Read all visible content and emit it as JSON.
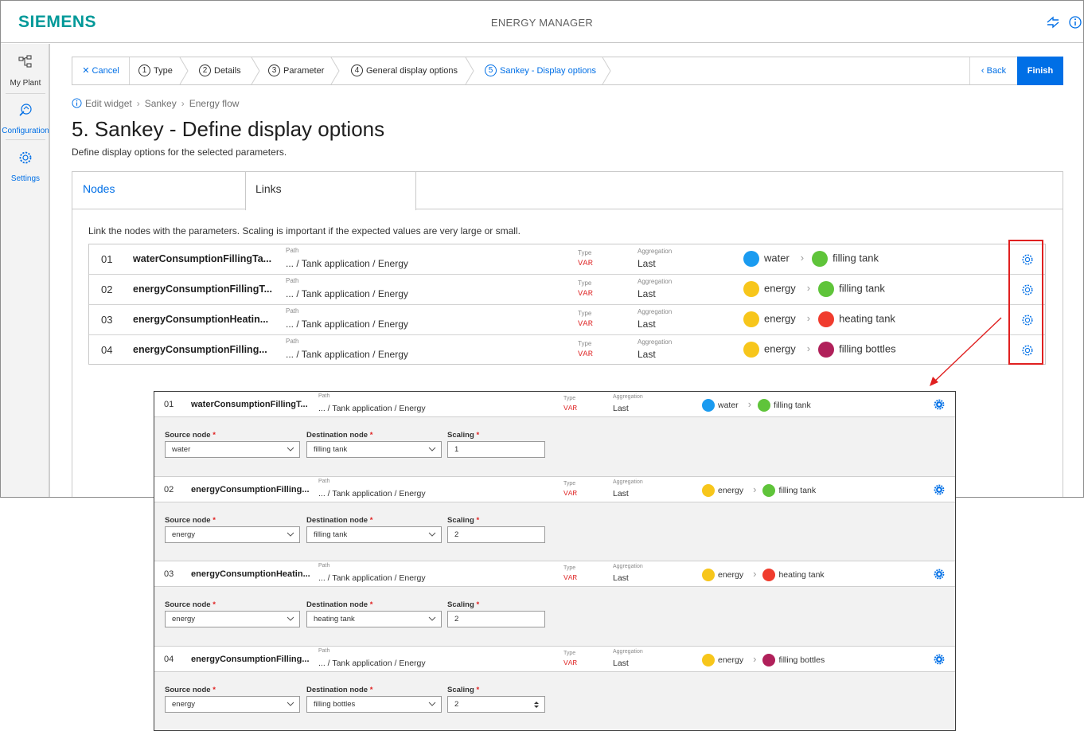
{
  "app": {
    "brand": "SIEMENS",
    "title": "ENERGY MANAGER",
    "colors": {
      "brand": "#009999",
      "accent": "#006fe6",
      "highlight": "#e02020"
    }
  },
  "sidebar": {
    "items": [
      {
        "label": "My Plant",
        "icon": "plant-tree-icon"
      },
      {
        "label": "Configuration",
        "icon": "configuration-icon"
      },
      {
        "label": "Settings",
        "icon": "gear-icon"
      }
    ]
  },
  "wizard": {
    "cancel": "Cancel",
    "steps": [
      {
        "num": "1",
        "label": "Type"
      },
      {
        "num": "2",
        "label": "Details"
      },
      {
        "num": "3",
        "label": "Parameter"
      },
      {
        "num": "4",
        "label": "General display options"
      },
      {
        "num": "5",
        "label": "Sankey - Display options"
      }
    ],
    "back": "Back",
    "finish": "Finish"
  },
  "breadcrumb": [
    "Edit widget",
    "Sankey",
    "Energy flow"
  ],
  "page": {
    "title": "5. Sankey - Define display options",
    "subtitle": "Define display options for the selected parameters."
  },
  "tabs": [
    "Nodes",
    "Links"
  ],
  "links_description": "Link the nodes with the parameters. Scaling is important if the expected values are very large or small.",
  "labels": {
    "path": "Path",
    "type": "Type",
    "aggregation": "Aggregation",
    "source_node": "Source node",
    "destination_node": "Destination node",
    "scaling": "Scaling",
    "required": "*"
  },
  "links": [
    {
      "num": "01",
      "name": "waterConsumptionFillingTa...",
      "path": "... / Tank application / Energy",
      "type": "VAR",
      "aggregation": "Last",
      "source": "water",
      "source_color": "#1a9bf0",
      "destination": "filling tank",
      "destination_color": "#5fc43a"
    },
    {
      "num": "02",
      "name": "energyConsumptionFillingT...",
      "path": "... / Tank application / Energy",
      "type": "VAR",
      "aggregation": "Last",
      "source": "energy",
      "source_color": "#f7c61b",
      "destination": "filling tank",
      "destination_color": "#5fc43a"
    },
    {
      "num": "03",
      "name": "energyConsumptionHeatin...",
      "path": "... / Tank application / Energy",
      "type": "VAR",
      "aggregation": "Last",
      "source": "energy",
      "source_color": "#f7c61b",
      "destination": "heating tank",
      "destination_color": "#f03c2e"
    },
    {
      "num": "04",
      "name": "energyConsumptionFilling...",
      "path": "... / Tank application / Energy",
      "type": "VAR",
      "aggregation": "Last",
      "source": "energy",
      "source_color": "#f7c61b",
      "destination": "filling bottles",
      "destination_color": "#b0205a"
    }
  ],
  "expanded_links": [
    {
      "num": "01",
      "name": "waterConsumptionFillingT...",
      "path": "... / Tank application / Energy",
      "type": "VAR",
      "aggregation": "Last",
      "source": "water",
      "source_color": "#1a9bf0",
      "destination": "filling tank",
      "destination_color": "#5fc43a",
      "source_select": "water",
      "destination_select": "filling tank",
      "scaling": "1"
    },
    {
      "num": "02",
      "name": "energyConsumptionFilling...",
      "path": "... / Tank application / Energy",
      "type": "VAR",
      "aggregation": "Last",
      "source": "energy",
      "source_color": "#f7c61b",
      "destination": "filling tank",
      "destination_color": "#5fc43a",
      "source_select": "energy",
      "destination_select": "filling tank",
      "scaling": "2"
    },
    {
      "num": "03",
      "name": "energyConsumptionHeatin...",
      "path": "... / Tank application / Energy",
      "type": "VAR",
      "aggregation": "Last",
      "source": "energy",
      "source_color": "#f7c61b",
      "destination": "heating tank",
      "destination_color": "#f03c2e",
      "source_select": "energy",
      "destination_select": "heating tank",
      "scaling": "2"
    },
    {
      "num": "04",
      "name": "energyConsumptionFilling...",
      "path": "... / Tank application / Energy",
      "type": "VAR",
      "aggregation": "Last",
      "source": "energy",
      "source_color": "#f7c61b",
      "destination": "filling bottles",
      "destination_color": "#b0205a",
      "source_select": "energy",
      "destination_select": "filling bottles",
      "scaling": "2"
    }
  ]
}
